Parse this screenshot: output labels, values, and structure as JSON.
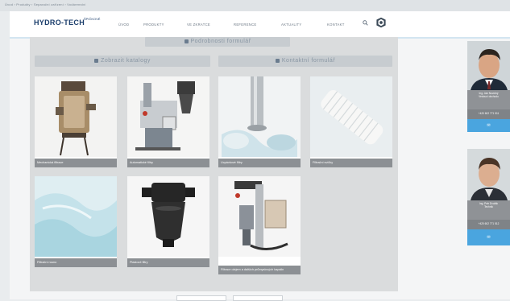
{
  "breadcrumb": {
    "text": "Úvod  ›  Produkty  ›  Separační zařízení  ›  Vodárenství"
  },
  "header": {
    "logo": "HYDRO-TECH",
    "logo_sup": "ŠPIČKOVÉ",
    "menu": [
      {
        "label": "ÚVOD"
      },
      {
        "label": "PRODUKTY"
      },
      {
        "label": "VE ZKRATCE"
      },
      {
        "label": "REFERENCE"
      },
      {
        "label": "AKTUALITY"
      },
      {
        "label": "KONTAKT"
      }
    ]
  },
  "content": {
    "top_header": "Podrobnosti formulář",
    "left_header": "Zobrazit katalogy",
    "right_header": "Kontaktní formulář",
    "cards": [
      {
        "caption": "Mechanická filtrace"
      },
      {
        "caption": "Automatické filtry"
      },
      {
        "caption": "Ucpávkové filtry"
      },
      {
        "caption": "Filtrační svíčky"
      },
      {
        "caption": "Filtrační rouno"
      },
      {
        "caption": "Plastové filtry"
      },
      {
        "caption": "Filtrace olejem a dalších průmyslových kapalin"
      }
    ],
    "pager": [
      {
        "label": ""
      },
      {
        "label": ""
      }
    ]
  },
  "sidebar": {
    "contacts": [
      {
        "name": "Ing. Jan Novotný",
        "role": "Vedoucí obchodu",
        "phone": "+420 602 771 511",
        "button": "✉"
      },
      {
        "name": "Ing. Petr Dvořák",
        "role": "Technik",
        "phone": "+420 602 771 512",
        "button": "✉"
      }
    ]
  },
  "colors": {
    "accent": "#4aa5df",
    "brand": "#1a3d6b",
    "caption_bg": "#8c9094"
  }
}
